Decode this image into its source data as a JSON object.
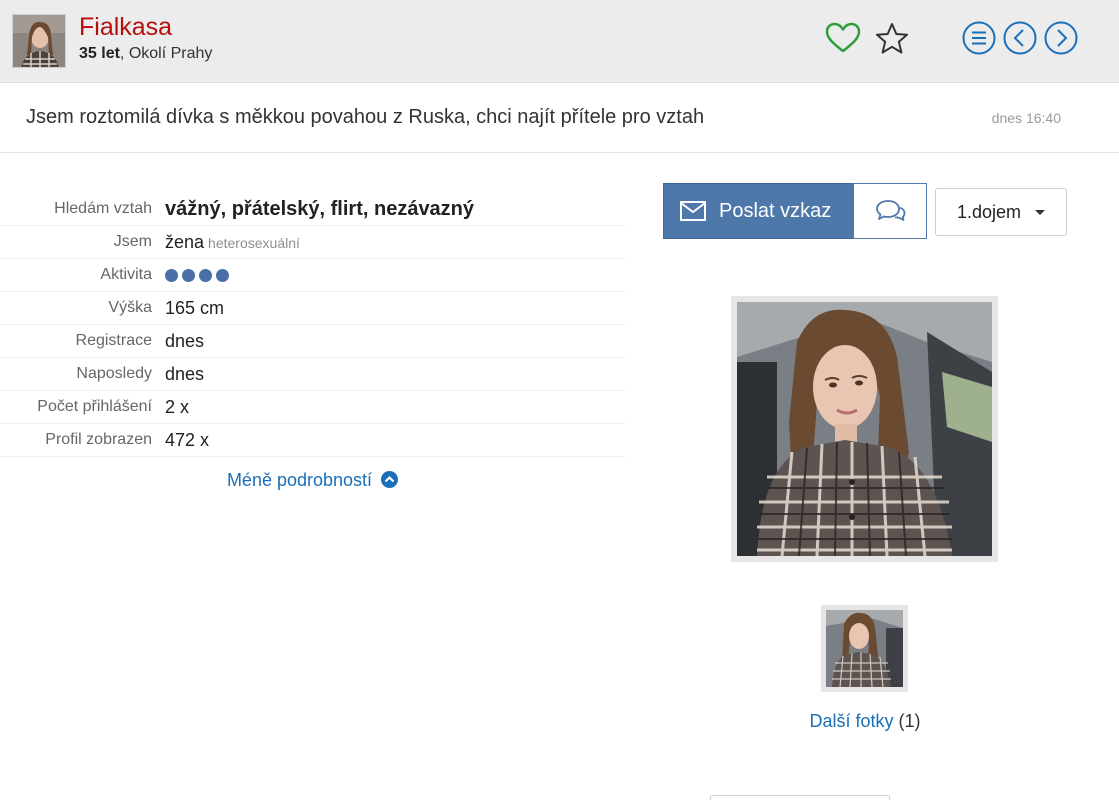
{
  "header": {
    "name": "Fialkasa",
    "age": "35 let",
    "location": ", Okolí Prahy",
    "icons": [
      "heart-icon",
      "star-icon",
      "menu-icon",
      "chevron-left-icon",
      "chevron-right-icon"
    ],
    "colors": {
      "name": "#b80d0d",
      "heart": "#2e9e3a",
      "accent": "#1a6fb8"
    }
  },
  "headline": {
    "text": "Jsem roztomilá dívka s měkkou povahou z Ruska, chci najít přítele pro vztah",
    "time": "dnes 16:40"
  },
  "details": {
    "rows": [
      {
        "label": "Hledám vztah",
        "value": "vážný, přátelský, flirt, nezávazný"
      },
      {
        "label": "Jsem",
        "value": "žena",
        "sub": "heterosexuální"
      },
      {
        "label": "Aktivita",
        "value": 4
      },
      {
        "label": "Výška",
        "value": "165 cm"
      },
      {
        "label": "Registrace",
        "value": "dnes"
      },
      {
        "label": "Naposledy",
        "value": "dnes"
      },
      {
        "label": "Počet přihlášení",
        "value": "2 x"
      },
      {
        "label": "Profil zobrazen",
        "value": "472 x"
      }
    ],
    "less_label": "Méně podrobností"
  },
  "actions": {
    "send_label": "Poslat vzkaz",
    "impression_label": "1.dojem"
  },
  "photos": {
    "more_label": "Další fotky",
    "more_count": "(1)"
  }
}
